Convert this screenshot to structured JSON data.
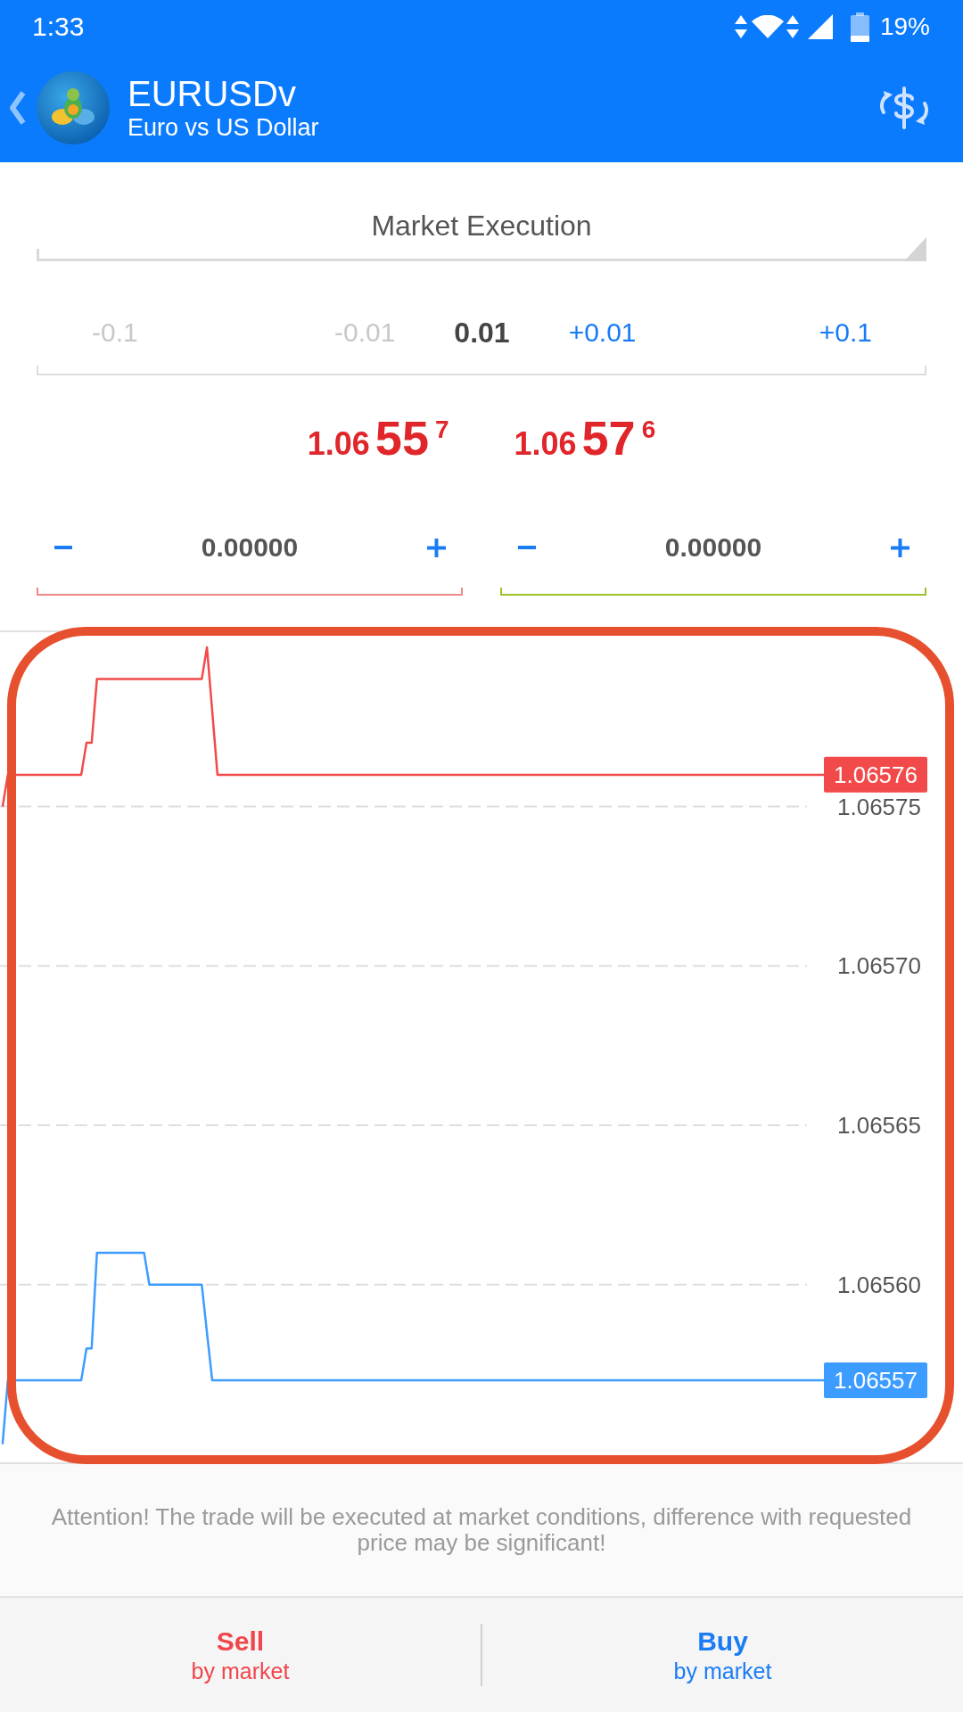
{
  "status_bar": {
    "time": "1:33",
    "battery": "19%"
  },
  "toolbar": {
    "title": "EURUSDv",
    "subtitle": "Euro vs US Dollar"
  },
  "order_type": {
    "value": "Market Execution"
  },
  "volume": {
    "decrease": [
      {
        "label": "-0.1",
        "disabled": true
      },
      {
        "label": "-0.01",
        "disabled": true
      }
    ],
    "value": "0.01",
    "increase": [
      {
        "label": "+0.01",
        "disabled": false
      },
      {
        "label": "+0.1",
        "disabled": false
      }
    ]
  },
  "quotes": [
    {
      "big_figure": "1.06",
      "pips": "55",
      "point": "7"
    },
    {
      "big_figure": "1.06",
      "pips": "57",
      "point": "6"
    }
  ],
  "price_fields": [
    {
      "value": "0.00000",
      "color": "#f08a8a"
    },
    {
      "value": "0.00000",
      "color": "#9cc22a"
    }
  ],
  "chart_data": {
    "type": "line",
    "grid": true,
    "categories": [
      null,
      null,
      null,
      null,
      null,
      null,
      null,
      null,
      null,
      null,
      null,
      null,
      null,
      null,
      null,
      null,
      null,
      null,
      null,
      null,
      null,
      null,
      null,
      null,
      null,
      null,
      null,
      null,
      null,
      null,
      null,
      null,
      null,
      null,
      null,
      null,
      null,
      null,
      null,
      null,
      null,
      null,
      null,
      null,
      null,
      null,
      null,
      null,
      null,
      null,
      null,
      null,
      null,
      null,
      null,
      null,
      null,
      null,
      null,
      null,
      null,
      null,
      null,
      null,
      null,
      null,
      null,
      null,
      null,
      null,
      null,
      null,
      null,
      null,
      null,
      null,
      null,
      null,
      null,
      null,
      null,
      null,
      null,
      null,
      null,
      null,
      null,
      null,
      null,
      null,
      null,
      null,
      null,
      null,
      null,
      null,
      null,
      null,
      null,
      null,
      null,
      null,
      null,
      null,
      null,
      null,
      null,
      null,
      null,
      null,
      null,
      null,
      null,
      null,
      null,
      null,
      null,
      null,
      null,
      null,
      null,
      null,
      null,
      null,
      null,
      null,
      null,
      null,
      null,
      null,
      null,
      null,
      null,
      null,
      null,
      null,
      null,
      null,
      null,
      null,
      null,
      null,
      null,
      null,
      null,
      null,
      null,
      null,
      null,
      null,
      null,
      null,
      null,
      null
    ],
    "ylim": [
      1.065544,
      1.065805
    ],
    "yticks": [
      {
        "value": 1.0656,
        "label": "1.06560"
      },
      {
        "value": 1.06565,
        "label": "1.06565"
      },
      {
        "value": 1.0657,
        "label": "1.06570"
      },
      {
        "value": 1.06575,
        "label": "1.06575"
      }
    ],
    "series": [
      {
        "color": "#f24a4a",
        "values": [
          1.06575,
          1.06576,
          1.06576,
          1.06576,
          1.06576,
          1.06576,
          1.06576,
          1.06576,
          1.06576,
          1.06576,
          1.06576,
          1.06576,
          1.06576,
          1.06576,
          1.06576,
          1.06576,
          1.06577,
          1.06577,
          1.06579,
          1.06579,
          1.06579,
          1.06579,
          1.06579,
          1.06579,
          1.06579,
          1.06579,
          1.06579,
          1.06579,
          1.06579,
          1.06579,
          1.06579,
          1.06579,
          1.06579,
          1.06579,
          1.06579,
          1.06579,
          1.06579,
          1.06579,
          1.06579,
          1.0658,
          1.06578,
          1.06576,
          1.06576,
          1.06576,
          1.06576,
          1.06576,
          1.06576,
          1.06576,
          1.06576,
          1.06576,
          1.06576,
          1.06576,
          1.06576,
          1.06576,
          1.06576,
          1.06576,
          1.06576,
          1.06576,
          1.06576,
          1.06576,
          1.06576,
          1.06576,
          1.06576,
          1.06576,
          1.06576,
          1.06576,
          1.06576,
          1.06576,
          1.06576,
          1.06576,
          1.06576,
          1.06576,
          1.06576,
          1.06576,
          1.06576,
          1.06576,
          1.06576,
          1.06576,
          1.06576,
          1.06576,
          1.06576,
          1.06576,
          1.06576,
          1.06576,
          1.06576,
          1.06576,
          1.06576,
          1.06576,
          1.06576,
          1.06576,
          1.06576,
          1.06576,
          1.06576,
          1.06576,
          1.06576,
          1.06576,
          1.06576,
          1.06576,
          1.06576,
          1.06576,
          1.06576,
          1.06576,
          1.06576,
          1.06576,
          1.06576,
          1.06576,
          1.06576,
          1.06576,
          1.06576,
          1.06576,
          1.06576,
          1.06576,
          1.06576,
          1.06576,
          1.06576,
          1.06576,
          1.06576,
          1.06576,
          1.06576,
          1.06576,
          1.06576,
          1.06576,
          1.06576,
          1.06576,
          1.06576,
          1.06576,
          1.06576,
          1.06576,
          1.06576,
          1.06576,
          1.06576,
          1.06576,
          1.06576,
          1.06576,
          1.06576,
          1.06576,
          1.06576,
          1.06576,
          1.06576,
          1.06576,
          1.06576,
          1.06576,
          1.06576,
          1.06576,
          1.06576,
          1.06576,
          1.06576,
          1.06576,
          1.06576,
          1.06576,
          1.06576,
          1.06576,
          1.06576,
          1.06576
        ]
      },
      {
        "color": "#3d9cff",
        "values": [
          1.06555,
          1.06557,
          1.06557,
          1.06557,
          1.06557,
          1.06557,
          1.06557,
          1.06557,
          1.06557,
          1.06557,
          1.06557,
          1.06557,
          1.06557,
          1.06557,
          1.06557,
          1.06557,
          1.06558,
          1.06558,
          1.06561,
          1.06561,
          1.06561,
          1.06561,
          1.06561,
          1.06561,
          1.06561,
          1.06561,
          1.06561,
          1.06561,
          1.0656,
          1.0656,
          1.0656,
          1.0656,
          1.0656,
          1.0656,
          1.0656,
          1.0656,
          1.0656,
          1.0656,
          1.0656,
          1.065585,
          1.06557,
          1.06557,
          1.06557,
          1.06557,
          1.06557,
          1.06557,
          1.06557,
          1.06557,
          1.06557,
          1.06557,
          1.06557,
          1.06557,
          1.06557,
          1.06557,
          1.06557,
          1.06557,
          1.06557,
          1.06557,
          1.06557,
          1.06557,
          1.06557,
          1.06557,
          1.06557,
          1.06557,
          1.06557,
          1.06557,
          1.06557,
          1.06557,
          1.06557,
          1.06557,
          1.06557,
          1.06557,
          1.06557,
          1.06557,
          1.06557,
          1.06557,
          1.06557,
          1.06557,
          1.06557,
          1.06557,
          1.06557,
          1.06557,
          1.06557,
          1.06557,
          1.06557,
          1.06557,
          1.06557,
          1.06557,
          1.06557,
          1.06557,
          1.06557,
          1.06557,
          1.06557,
          1.06557,
          1.06557,
          1.06557,
          1.06557,
          1.06557,
          1.06557,
          1.06557,
          1.06557,
          1.06557,
          1.06557,
          1.06557,
          1.06557,
          1.06557,
          1.06557,
          1.06557,
          1.06557,
          1.06557,
          1.06557,
          1.06557,
          1.06557,
          1.06557,
          1.06557,
          1.06557,
          1.06557,
          1.06557,
          1.06557,
          1.06557,
          1.06557,
          1.06557,
          1.06557,
          1.06557,
          1.06557,
          1.06557,
          1.06557,
          1.06557,
          1.06557,
          1.06557,
          1.06557,
          1.06557,
          1.06557,
          1.06557,
          1.06557,
          1.06557,
          1.06557,
          1.06557,
          1.06557,
          1.06557,
          1.06557,
          1.06557,
          1.06557,
          1.06557,
          1.06557,
          1.06557,
          1.06557,
          1.06557,
          1.06557,
          1.06557,
          1.06557,
          1.06557,
          1.06557,
          1.06557
        ]
      }
    ],
    "annotations": [
      "1.06576",
      "1.06557"
    ]
  },
  "notice": "Attention! The trade will be executed at market conditions, difference with requested price may be significant!",
  "actions": [
    {
      "label": "Sell",
      "sublabel": "by market",
      "color": "#f0464b"
    },
    {
      "label": "Buy",
      "sublabel": "by market",
      "color": "#1a7cf5"
    }
  ]
}
